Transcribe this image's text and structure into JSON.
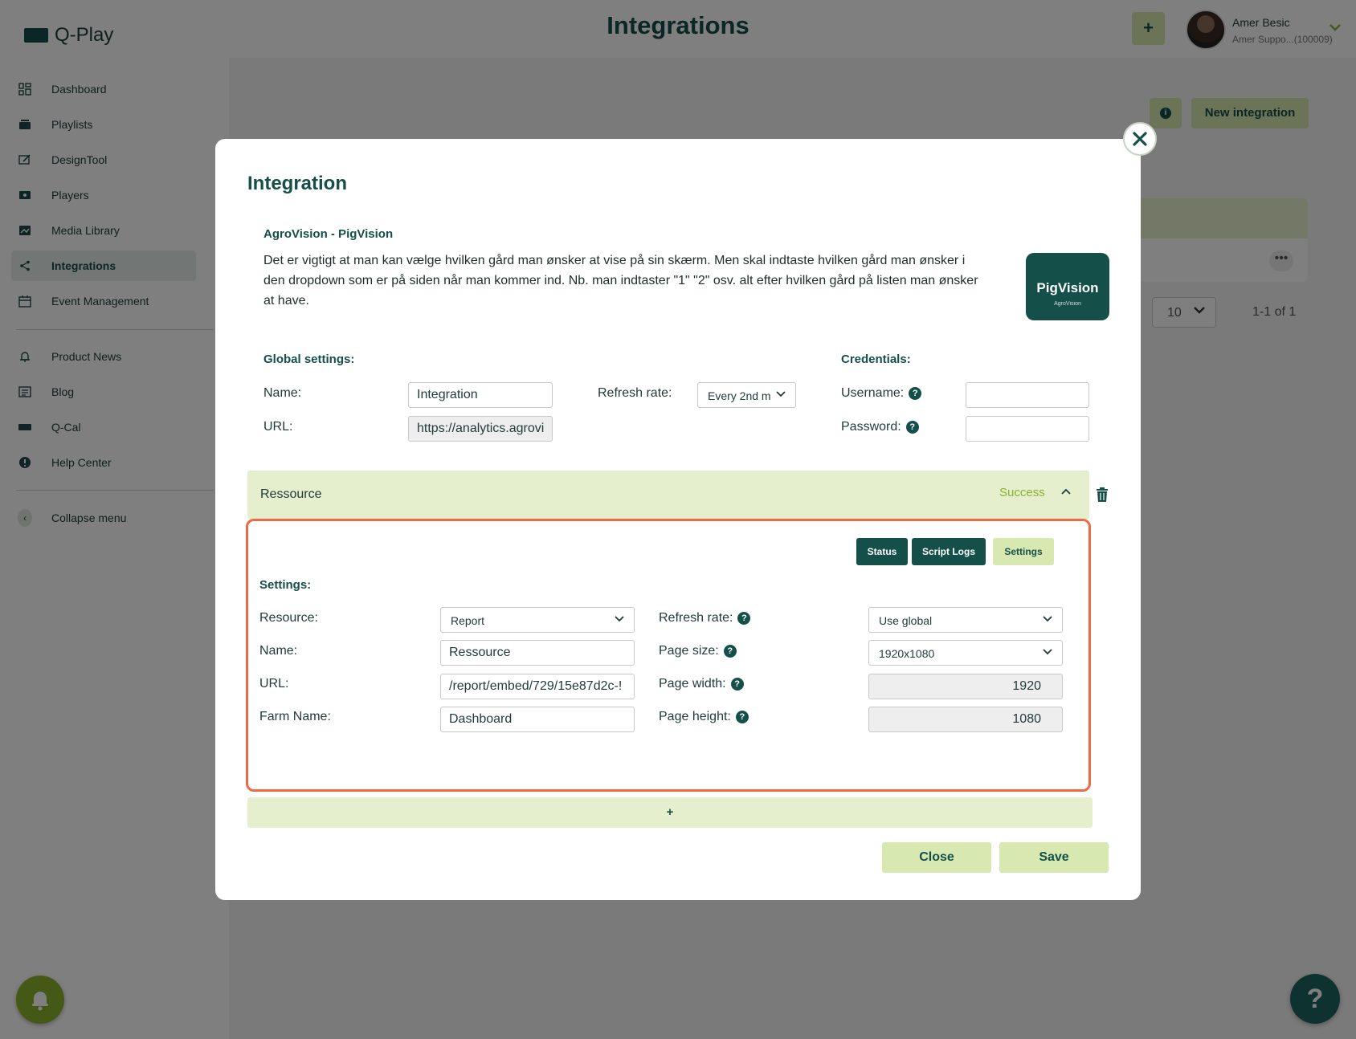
{
  "app": {
    "logo_text": "Q-Play",
    "page_title": "Integrations",
    "add_label": "+",
    "user": {
      "name": "Amer Besic",
      "subtitle": "Amer Suppo...(100009)"
    }
  },
  "sidebar": {
    "items": [
      {
        "label": "Dashboard",
        "icon": "dashboard-icon"
      },
      {
        "label": "Playlists",
        "icon": "playlist-icon"
      },
      {
        "label": "DesignTool",
        "icon": "design-icon"
      },
      {
        "label": "Players",
        "icon": "player-icon"
      },
      {
        "label": "Media Library",
        "icon": "media-icon"
      },
      {
        "label": "Integrations",
        "icon": "share-icon",
        "active": true
      },
      {
        "label": "Event Management",
        "icon": "calendar-icon"
      }
    ],
    "secondary": [
      {
        "label": "Product News",
        "icon": "bell-icon"
      },
      {
        "label": "Blog",
        "icon": "newspaper-icon"
      },
      {
        "label": "Q-Cal",
        "icon": "qcal-icon"
      },
      {
        "label": "Help Center",
        "icon": "alert-icon"
      }
    ],
    "collapse_label": "Collapse menu"
  },
  "background": {
    "new_integration_label": "New integration",
    "info_label": "i",
    "more_label": "•••",
    "per_page_fragment": "e",
    "per_page_value": "10",
    "page_count": "1-1 of 1"
  },
  "modal": {
    "title": "Integration",
    "integration_name": "AgroVision - PigVision",
    "description": "Det er vigtigt at man kan vælge hvilken gård man ønsker at vise på sin skærm. Men skal indtaste hvilken gård man ønsker i den dropdown som er på siden når man kommer ind. Nb. man indtaster \"1\" \"2\" osv. alt efter hvilken gård på listen man ønsker at have.",
    "logo_title": "PigVision",
    "logo_sub": "AgroVision",
    "global": {
      "heading": "Global settings:",
      "name_label": "Name:",
      "name_value": "Integration",
      "url_label": "URL:",
      "url_value": "https://analytics.agrovi",
      "refresh_label": "Refresh rate:",
      "refresh_value": "Every 2nd m"
    },
    "credentials": {
      "heading": "Credentials:",
      "username_label": "Username:",
      "username_value": "",
      "password_label": "Password:",
      "password_value": ""
    },
    "resource": {
      "title": "Ressource",
      "status": "Success",
      "tabs": [
        "Status",
        "Script Logs",
        "Settings"
      ],
      "settings_heading": "Settings:",
      "fields": {
        "resource_label": "Resource:",
        "resource_value": "Report",
        "name_label": "Name:",
        "name_value": "Ressource",
        "url_label": "URL:",
        "url_value": "/report/embed/729/15e87d2c-!",
        "farm_label": "Farm Name:",
        "farm_value": "Dashboard",
        "refresh_label": "Refresh rate:",
        "refresh_value": "Use global",
        "page_size_label": "Page size:",
        "page_size_value": "1920x1080",
        "page_width_label": "Page width:",
        "page_width_value": "1920",
        "page_height_label": "Page height:",
        "page_height_value": "1080"
      }
    },
    "add_label": "+",
    "close_label": "Close",
    "save_label": "Save"
  },
  "fab": {
    "help_label": "?"
  },
  "colors": {
    "brand": "#154f4a",
    "accent": "#8bb32c",
    "light": "#d8e8b1",
    "highlight": "#ee6a44"
  }
}
